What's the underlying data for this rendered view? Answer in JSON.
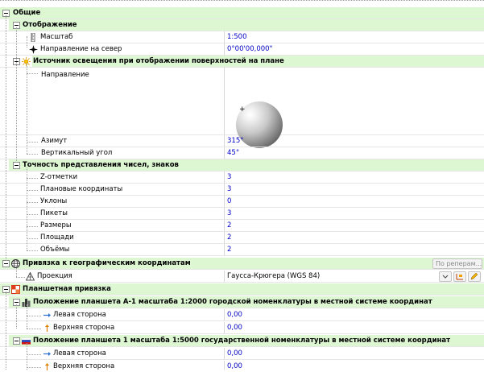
{
  "section_general": {
    "label": "Общие"
  },
  "section_display": {
    "label": "Отображение"
  },
  "scale": {
    "label": "Масштаб",
    "value": "1:500"
  },
  "north_direction": {
    "label": "Направление на север",
    "value": "0°00'00,000\""
  },
  "light_source": {
    "label": "Источник освещения при отображении поверхностей на плане"
  },
  "light_direction": {
    "label": "Направление"
  },
  "azimuth": {
    "label": "Азимут",
    "value": "315°"
  },
  "vertical_angle": {
    "label": "Вертикальный угол",
    "value": "45°"
  },
  "precision": {
    "label": "Точность представления чисел, знаков"
  },
  "z_marks": {
    "label": "Z-отметки",
    "value": "3"
  },
  "plan_coords": {
    "label": "Плановые координаты",
    "value": "3"
  },
  "slopes": {
    "label": "Уклоны",
    "value": "0"
  },
  "pickets": {
    "label": "Пикеты",
    "value": "3"
  },
  "sizes": {
    "label": "Размеры",
    "value": "2"
  },
  "areas": {
    "label": "Площади",
    "value": "2"
  },
  "volumes": {
    "label": "Объёмы",
    "value": "2"
  },
  "geo_binding": {
    "label": "Привязка к географическим координатам",
    "button": "По реперам..."
  },
  "projection": {
    "label": "Проекция",
    "value": "Гаусса-Крюгера (WGS 84)"
  },
  "sheet_binding": {
    "label": "Планшетная привязка"
  },
  "sheet_a1": {
    "label": "Положение планшета А-1 масштаба 1:2000 городской номенклатуры в местной системе координат",
    "left": {
      "label": "Левая сторона",
      "value": "0,00"
    },
    "top": {
      "label": "Верхняя сторона",
      "value": "0,00"
    }
  },
  "sheet_1": {
    "label": "Положение планшета 1 масштаба 1:5000  государственной номенклатуры в местной системе координат",
    "left": {
      "label": "Левая сторона",
      "value": "0,00"
    },
    "top": {
      "label": "Верхняя сторона",
      "value": "0,00"
    }
  },
  "colors": {
    "group_header_bg": "#ddf7d3",
    "value_text": "#0000c8",
    "separator": "#e6e6e6"
  },
  "icons": {
    "scale": "ruler-icon",
    "north": "compass-icon",
    "light": "sun-icon",
    "geo": "globe-icon",
    "projection": "projection-icon",
    "sheet": "sheet-icon",
    "sheet_a1": "city-icon",
    "sheet_1": "flag-icon",
    "left_side": "arrow-right-icon",
    "top_side": "arrow-up-icon"
  }
}
